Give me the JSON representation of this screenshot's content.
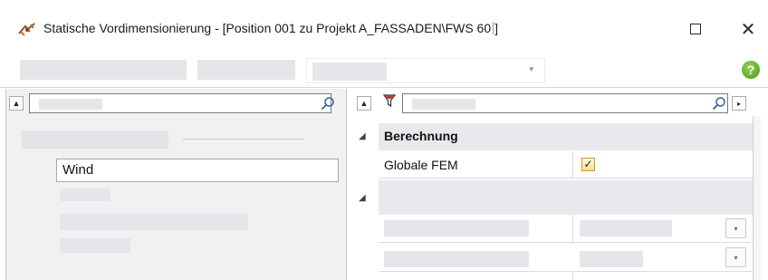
{
  "window": {
    "title_left": "Statische Vordimensionierung - [Position 001  zu Projekt  A_FASSADEN\\FWS 60",
    "title_right": "]",
    "maximize_glyph": "",
    "close_glyph": "✕"
  },
  "toolbar": {
    "combo_arrow": "▾",
    "help_label": "?"
  },
  "left_pane": {
    "collapse_glyph": "▲",
    "search_value": "",
    "selected_item": "Wind"
  },
  "right_pane": {
    "collapse_glyph": "▲",
    "filter_icon": "funnel-icon",
    "nav_glyph": "▸",
    "search_value": "",
    "categories": [
      {
        "label": "Berechnung",
        "expander": "◢"
      },
      {
        "label": "",
        "expander": "◢"
      }
    ],
    "properties": [
      {
        "name": "Globale FEM",
        "checked": true,
        "check_glyph": "✓"
      }
    ],
    "dropdown_glyph": "▾"
  },
  "colors": {
    "selection_border": "#7a7a7a",
    "placeholder": "#e4e6ea",
    "checkbox_fill": "#f6dd8d",
    "help_icon": "#5aaa28"
  }
}
